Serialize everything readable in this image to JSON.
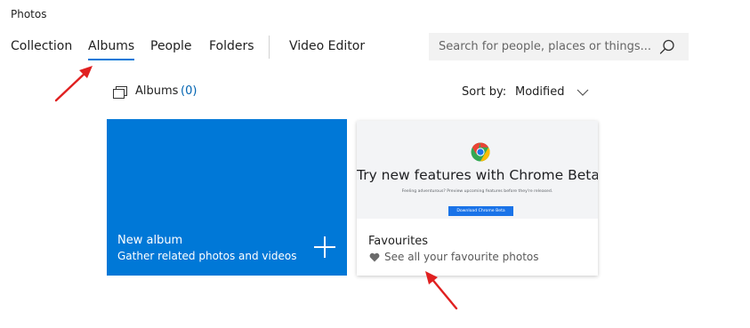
{
  "app": {
    "title": "Photos"
  },
  "nav": {
    "tabs": [
      {
        "label": "Collection",
        "active": false
      },
      {
        "label": "Albums",
        "active": true
      },
      {
        "label": "People",
        "active": false
      },
      {
        "label": "Folders",
        "active": false
      },
      {
        "label": "Video Editor",
        "active": false
      }
    ]
  },
  "search": {
    "placeholder": "Search for people, places or things...",
    "value": "",
    "icon": "search-icon"
  },
  "albums": {
    "label": "Albums",
    "count": "(0)",
    "icon": "albums-icon"
  },
  "sort": {
    "label": "Sort by:",
    "value": "Modified",
    "icon": "chevron-down-icon"
  },
  "new_album": {
    "title": "New album",
    "subtitle": "Gather related photos and videos",
    "icon": "plus-icon"
  },
  "favourites": {
    "thumbnail": {
      "title": "Try new features with Chrome Beta",
      "subtitle": "Feeling adventurous? Preview upcoming features before they're released.",
      "button": "Download Chrome Beta",
      "icon": "chrome-beta-icon"
    },
    "title": "Favourites",
    "subtitle": "See all your favourite photos",
    "icon": "heart-icon"
  },
  "colors": {
    "accent": "#0078d7",
    "annotation_arrow": "#e02020",
    "search_bg": "#f2f2f2"
  }
}
